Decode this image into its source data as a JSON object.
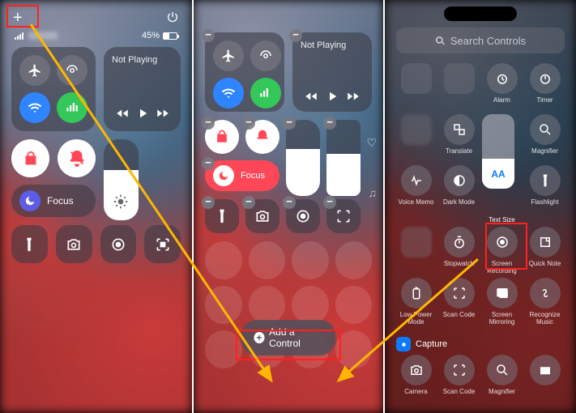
{
  "panel1": {
    "battery_pct": "45%",
    "connectivity": {
      "airplane": "airplane-icon",
      "airdrop": "airdrop-icon",
      "wifi": "wifi-icon",
      "group": "signal-wifi-bt-icon"
    },
    "media": {
      "not_playing": "Not Playing"
    },
    "focus_label": "Focus",
    "small_tiles": [
      "flashlight",
      "camera",
      "screen-record",
      "qr-scan"
    ]
  },
  "panel2": {
    "media_not_playing": "Not Playing",
    "focus_label": "Focus",
    "add_control": "Add a Control"
  },
  "panel3": {
    "search_placeholder": "Search Controls",
    "controls_r1": [
      {
        "name": "alarm",
        "label": "Alarm"
      },
      {
        "name": "timer",
        "label": "Timer"
      }
    ],
    "controls_r2": [
      {
        "name": "translate",
        "label": "Translate"
      },
      {
        "name": "magnifier",
        "label": "Magnifier"
      }
    ],
    "controls_r3": [
      {
        "name": "voice-memo",
        "label": "Voice Memo"
      },
      {
        "name": "dark-mode",
        "label": "Dark Mode"
      },
      {
        "name": "text-size",
        "label": "Text Size",
        "badge": "AA"
      },
      {
        "name": "flashlight",
        "label": "Flashlight"
      }
    ],
    "controls_r4": [
      {
        "name": "stopwatch",
        "label": "Stopwatch"
      },
      {
        "name": "screen-recording",
        "label": "Screen Recording"
      },
      {
        "name": "quick-note",
        "label": "Quick Note"
      }
    ],
    "controls_r5": [
      {
        "name": "low-power",
        "label": "Low Power Mode"
      },
      {
        "name": "scan-code",
        "label": "Scan Code"
      },
      {
        "name": "screen-mirroring",
        "label": "Screen Mirroring"
      },
      {
        "name": "recognize-music",
        "label": "Recognize Music"
      }
    ],
    "capture_header": "Capture",
    "capture_row": [
      {
        "name": "camera",
        "label": "Camera"
      },
      {
        "name": "scan-code-2",
        "label": "Scan Code"
      },
      {
        "name": "magnifier-2",
        "label": "Magnifier"
      },
      {
        "name": "more",
        "label": ""
      }
    ]
  }
}
